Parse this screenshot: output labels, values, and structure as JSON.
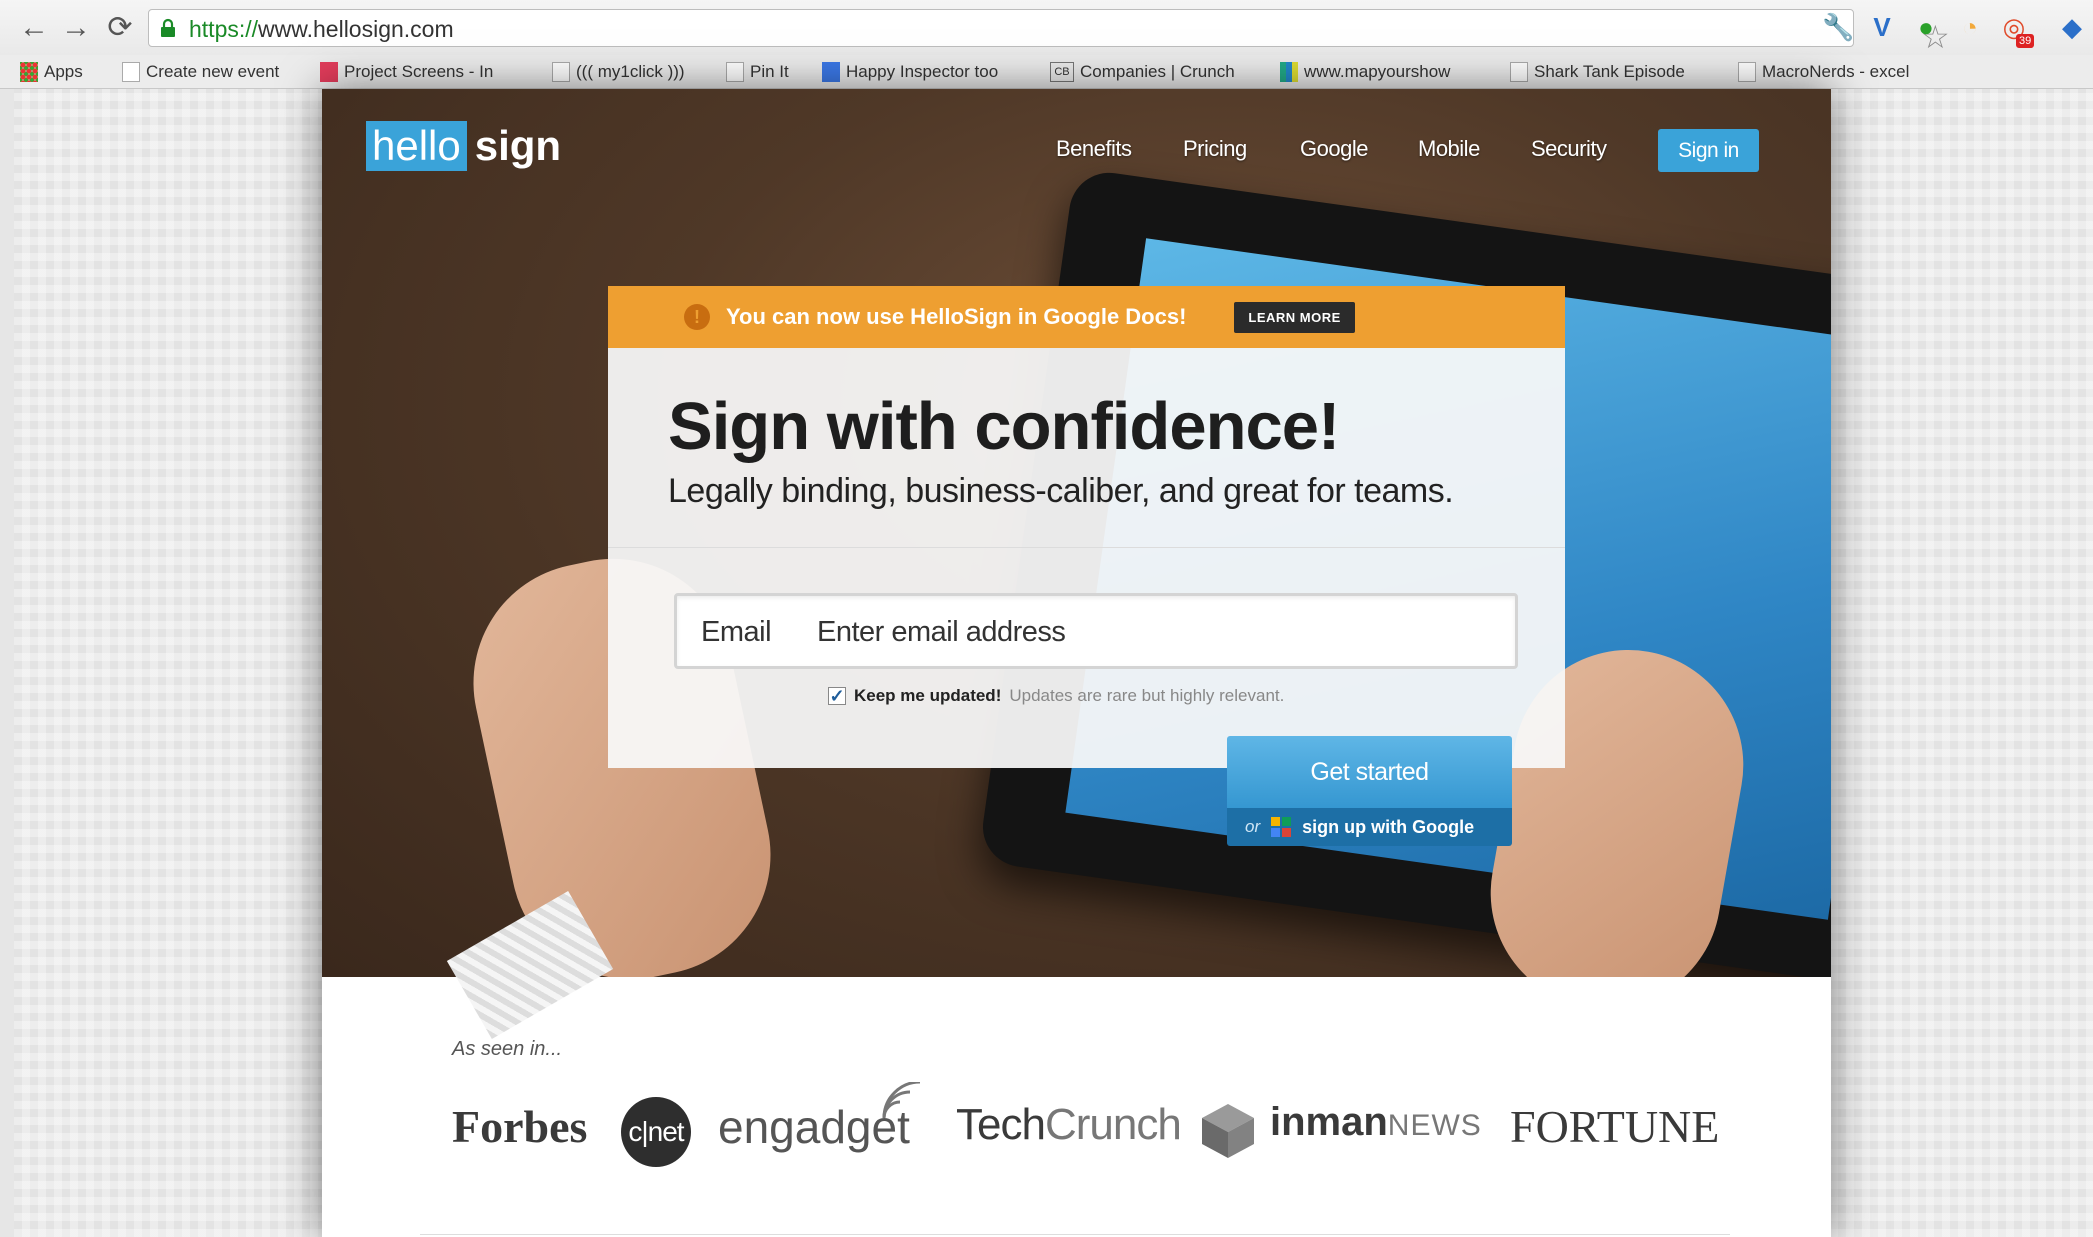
{
  "browser": {
    "url_scheme": "https://",
    "url_rest": "www.hellosign.com",
    "bookmarks": [
      {
        "label": "Apps"
      },
      {
        "label": "Create new event"
      },
      {
        "label": "Project Screens - In"
      },
      {
        "label": "((( my1click )))"
      },
      {
        "label": "Pin It"
      },
      {
        "label": "Happy Inspector too"
      },
      {
        "label": "Companies | Crunch"
      },
      {
        "label": "www.mapyourshow"
      },
      {
        "label": "Shark Tank Episode"
      },
      {
        "label": "MacroNerds - excel"
      }
    ],
    "extension_badge": "39"
  },
  "site": {
    "logo": {
      "hello": "hello",
      "sign": "sign"
    },
    "nav": [
      "Benefits",
      "Pricing",
      "Google",
      "Mobile",
      "Security"
    ],
    "signin_label": "Sign in",
    "banner": {
      "icon": "!",
      "text": "You can now use HelloSign in Google Docs!",
      "cta": "LEARN MORE"
    },
    "headline": "Sign with confidence!",
    "subhead": "Legally binding, business-caliber, and great for teams.",
    "email": {
      "label": "Email",
      "placeholder": "Enter email address",
      "value": ""
    },
    "keep_updated": {
      "checked": true,
      "bold": "Keep me updated!",
      "note": "Updates are rare but highly relevant."
    },
    "cta": {
      "primary": "Get started",
      "or": "or",
      "google": "sign up with Google"
    },
    "press": {
      "intro": "As seen in...",
      "forbes": "Forbes",
      "cnet": "c|net",
      "engadget": "engadget",
      "techcrunch_a": "Tech",
      "techcrunch_b": "Crunch",
      "inman": "inman",
      "inman_news": "NEWS",
      "fortune": "FORTUNE"
    }
  },
  "colors": {
    "brand_blue": "#3aa3d9",
    "banner_orange": "#ee9f31",
    "google_bar": "#1d6fa6"
  }
}
